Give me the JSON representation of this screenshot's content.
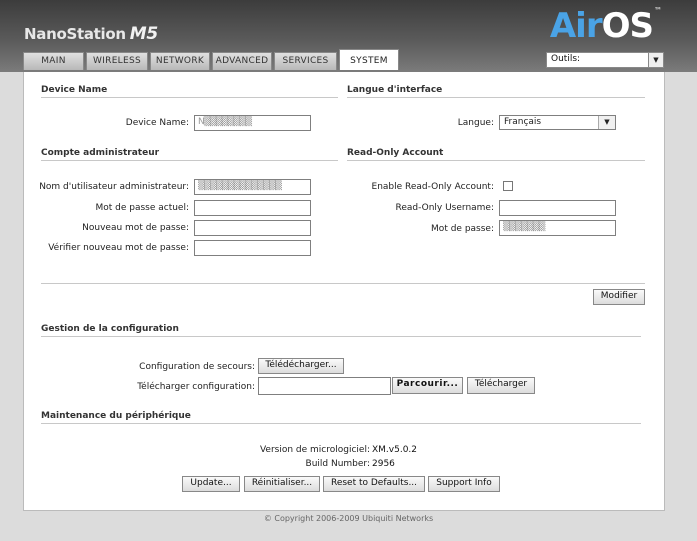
{
  "header": {
    "brand": "NanoStation",
    "model": "M5",
    "logo_air": "Air",
    "logo_os": "OS",
    "logo_tm": "™",
    "tools_value": "Outils:"
  },
  "tabs": [
    {
      "label": "MAIN"
    },
    {
      "label": "WIRELESS"
    },
    {
      "label": "NETWORK"
    },
    {
      "label": "ADVANCED"
    },
    {
      "label": "SERVICES"
    },
    {
      "label": "SYSTEM"
    }
  ],
  "device_name": {
    "section": "Device Name",
    "label": "Device Name:",
    "value": "N▒▒▒▒▒▒▒▒"
  },
  "language": {
    "section": "Langue d'interface",
    "label": "Langue:",
    "value": "Français"
  },
  "admin": {
    "section": "Compte administrateur",
    "user_label": "Nom d'utilisateur administrateur:",
    "user_value": "▒▒▒▒▒▒▒▒▒▒▒▒▒▒",
    "current_pw_label": "Mot de passe actuel:",
    "new_pw_label": "Nouveau mot de passe:",
    "verify_pw_label": "Vérifier nouveau mot de passe:"
  },
  "readonly": {
    "section": "Read-Only Account",
    "enable_label": "Enable Read-Only Account:",
    "username_label": "Read-Only Username:",
    "password_label": "Mot de passe:",
    "password_value": "▒▒▒▒▒▒▒"
  },
  "modify_button": "Modifier",
  "config": {
    "section": "Gestion de la configuration",
    "backup_label": "Configuration de secours:",
    "backup_button": "Télédécharger...",
    "upload_label": "Télécharger configuration:",
    "browse_button": "Parcourir...",
    "upload_button": "Télécharger"
  },
  "maintenance": {
    "section": "Maintenance du périphérique",
    "firmware_label": "Version de micrologiciel:",
    "firmware_value": "XM.v5.0.2",
    "build_label": "Build Number:",
    "build_value": "2956",
    "update_button": "Update...",
    "reboot_button": "Réinitialiser...",
    "reset_button": "Reset to Defaults...",
    "support_button": "Support Info"
  },
  "footer": "© Copyright 2006-2009 Ubiquiti Networks",
  "colors": {
    "logo_blue": "#4aa3e6",
    "header_dark": "#3c3c3c"
  }
}
